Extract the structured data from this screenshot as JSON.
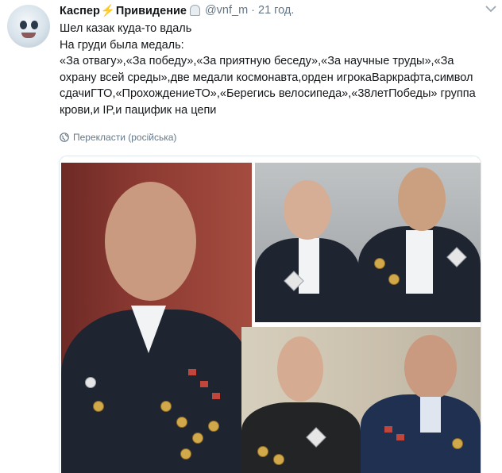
{
  "tweet": {
    "author_name_part1": "Каспер",
    "author_name_part2": "Привидение",
    "handle": "@vnf_m",
    "separator": "·",
    "time": "21 год.",
    "lines": [
      "Шел казак куда-то вдаль",
      "На груди была медаль:",
      "«За отвагу»,«За победу»,«За приятную беседу»,«За научные труды»,«За",
      "охрану всей среды»,две медали космонавта,орден игрокаВаркрафта,символ",
      "сдачиГТО,«ПрохождениеТО»,«Берегись велосипеда»,«38летПобеды» группа",
      "крови,и IP,и пацифик на цепи"
    ],
    "translate_label": "Перекласти (російська)"
  },
  "icons": {
    "bolt": "lightning-icon",
    "ghost": "ghost-emoji-icon",
    "chevron": "chevron-down-icon",
    "globe": "globe-icon"
  },
  "colors": {
    "text": "#14171a",
    "muted": "#657786",
    "border": "#e1e8ed",
    "bolt": "#f5a623"
  }
}
